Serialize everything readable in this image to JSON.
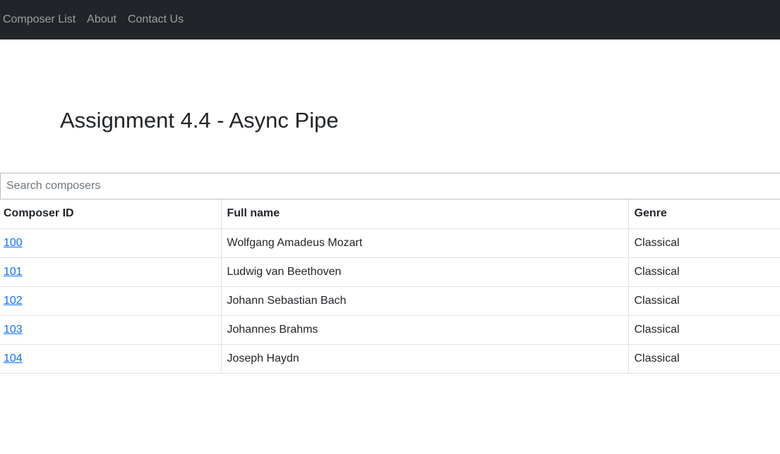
{
  "nav": {
    "items": [
      {
        "label": "Composer List"
      },
      {
        "label": "About"
      },
      {
        "label": "Contact Us"
      }
    ]
  },
  "page": {
    "title": "Assignment 4.4 - Async Pipe"
  },
  "search": {
    "placeholder": "Search composers",
    "value": ""
  },
  "table": {
    "headers": {
      "id": "Composer ID",
      "name": "Full name",
      "genre": "Genre"
    },
    "rows": [
      {
        "id": "100",
        "name": "Wolfgang Amadeus Mozart",
        "genre": "Classical"
      },
      {
        "id": "101",
        "name": "Ludwig van Beethoven",
        "genre": "Classical"
      },
      {
        "id": "102",
        "name": "Johann Sebastian Bach",
        "genre": "Classical"
      },
      {
        "id": "103",
        "name": "Johannes Brahms",
        "genre": "Classical"
      },
      {
        "id": "104",
        "name": "Joseph Haydn",
        "genre": "Classical"
      }
    ]
  },
  "colors": {
    "navbar_bg": "#212529",
    "link": "#0d6efd"
  }
}
